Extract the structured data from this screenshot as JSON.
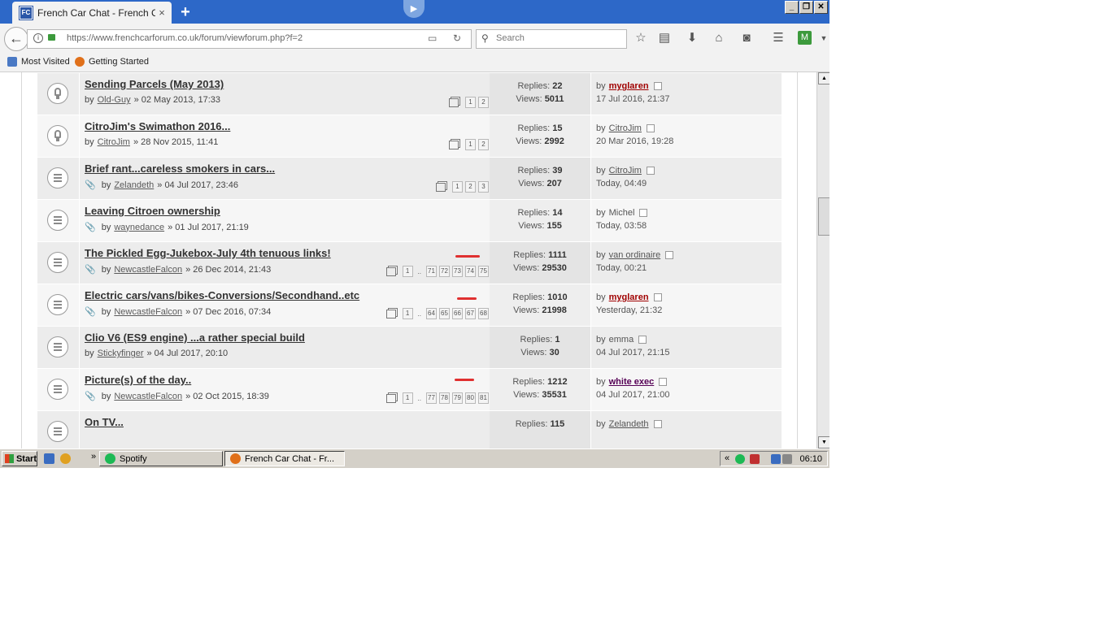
{
  "browser": {
    "tab_title": "French Car Chat - French Ca...",
    "tab_close": "×",
    "new_tab": "+",
    "url": "https://www.frenchcarforum.co.uk/forum/viewforum.php?f=2",
    "search_placeholder": "Search",
    "bookmarks": [
      "Most Visited",
      "Getting Started"
    ]
  },
  "topics": [
    {
      "title": "Sending Parcels (May 2013)",
      "author": "Old-Guy",
      "date": "» 02 May 2013, 17:33",
      "attachment": false,
      "icon": "bulb",
      "pages": [
        "1",
        "2"
      ],
      "pages_tail": [],
      "replies": "22",
      "views": "5011",
      "last_by": "myglaren",
      "last_by_style": "mod",
      "last_time": "17 Jul 2016, 21:37"
    },
    {
      "title": "CitroJim's Swimathon 2016...",
      "author": "CitroJim",
      "date": "» 28 Nov 2015, 11:41",
      "attachment": false,
      "icon": "bulb",
      "pages": [
        "1",
        "2"
      ],
      "pages_tail": [],
      "replies": "15",
      "views": "2992",
      "last_by": "CitroJim",
      "last_by_style": "normal",
      "last_time": "20 Mar 2016, 19:28"
    },
    {
      "title": "Brief rant...careless smokers in cars...",
      "author": "Zelandeth",
      "date": "» 04 Jul 2017, 23:46",
      "attachment": true,
      "icon": "topic",
      "pages": [
        "1",
        "2",
        "3"
      ],
      "pages_tail": [],
      "replies": "39",
      "views": "207",
      "last_by": "CitroJim",
      "last_by_style": "normal",
      "last_time": "Today, 04:49"
    },
    {
      "title": "Leaving Citroen ownership",
      "author": "waynedance",
      "date": "» 01 Jul 2017, 21:19",
      "attachment": true,
      "icon": "topic",
      "pages": [],
      "pages_tail": [],
      "replies": "14",
      "views": "155",
      "last_by": "Michel",
      "last_by_style": "plain",
      "last_time": "Today, 03:58"
    },
    {
      "title": "The Pickled Egg-Jukebox-July 4th tenuous links!",
      "author": "NewcastleFalcon",
      "date": "» 26 Dec 2014, 21:43",
      "attachment": true,
      "icon": "topic",
      "pages": [
        "1"
      ],
      "pages_tail": [
        "71",
        "72",
        "73",
        "74",
        "75"
      ],
      "replies": "1111",
      "views": "29530",
      "last_by": "van ordinaire",
      "last_by_style": "normal",
      "last_time": "Today, 00:21"
    },
    {
      "title": "Electric cars/vans/bikes-Conversions/Secondhand..etc",
      "author": "NewcastleFalcon",
      "date": "» 07 Dec 2016, 07:34",
      "attachment": true,
      "icon": "topic",
      "pages": [
        "1"
      ],
      "pages_tail": [
        "64",
        "65",
        "66",
        "67",
        "68"
      ],
      "replies": "1010",
      "views": "21998",
      "last_by": "myglaren",
      "last_by_style": "mod",
      "last_time": "Yesterday, 21:32"
    },
    {
      "title": "Clio V6 (ES9 engine) ...a rather special build",
      "author": "Stickyfinger",
      "date": "» 04 Jul 2017, 20:10",
      "attachment": false,
      "icon": "topic",
      "pages": [],
      "pages_tail": [],
      "replies": "1",
      "views": "30",
      "last_by": "emma",
      "last_by_style": "plain",
      "last_time": "04 Jul 2017, 21:15"
    },
    {
      "title": "Picture(s) of the day..",
      "author": "NewcastleFalcon",
      "date": "» 02 Oct 2015, 18:39",
      "attachment": true,
      "icon": "topic",
      "pages": [
        "1"
      ],
      "pages_tail": [
        "77",
        "78",
        "79",
        "80",
        "81"
      ],
      "replies": "1212",
      "views": "35531",
      "last_by": "white exec",
      "last_by_style": "adm",
      "last_time": "04 Jul 2017, 21:00"
    },
    {
      "title": "On TV...",
      "author": "",
      "date": "",
      "attachment": false,
      "icon": "topic",
      "pages": [],
      "pages_tail": [],
      "replies": "115",
      "views": "",
      "last_by": "Zelandeth",
      "last_by_style": "normal",
      "last_time": ""
    }
  ],
  "labels": {
    "by": "by",
    "replies": "Replies:",
    "views": "Views:",
    "ellipsis": "..."
  },
  "taskbar": {
    "start": "Start",
    "tasks": [
      "Spotify",
      "French Car Chat - Fr..."
    ],
    "tray_chevron": "«",
    "clock": "06:10"
  },
  "colors": {
    "title_bar": "#2d68c8",
    "mod_user": "#a00000",
    "admin_user": "#550055",
    "annotation_mark": "#e03030"
  }
}
